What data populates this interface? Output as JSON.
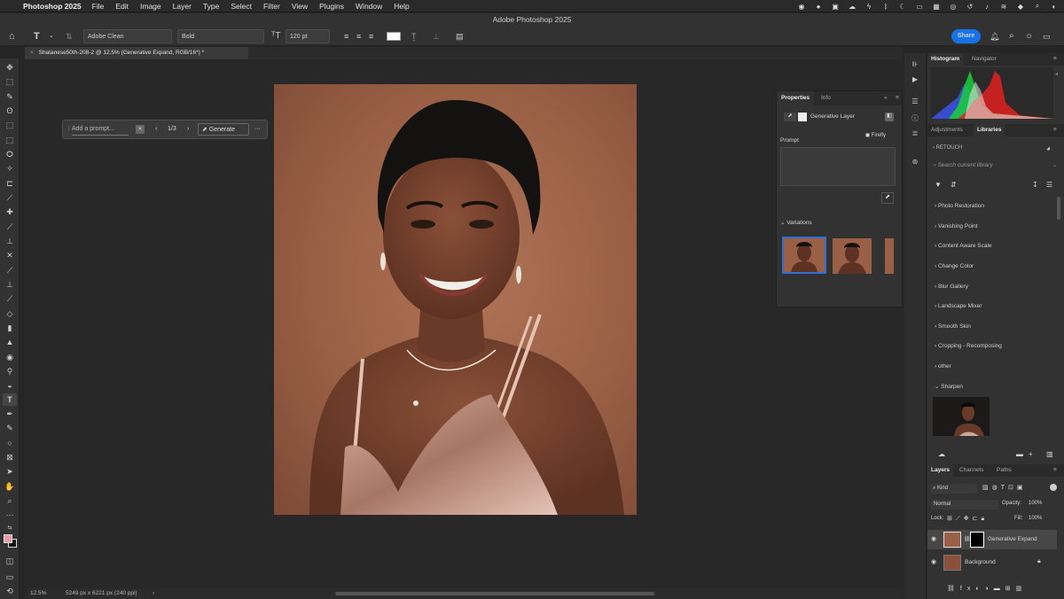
{
  "menubar": {
    "app_name": "Photoshop 2025",
    "items": [
      "File",
      "Edit",
      "Image",
      "Layer",
      "Type",
      "Select",
      "Filter",
      "View",
      "Plugins",
      "Window",
      "Help"
    ]
  },
  "window_title": "Adobe Photoshop 2025",
  "options": {
    "font_family": "Adobe Clean",
    "font_style": "Bold",
    "font_size": "120 pt",
    "share_label": "Share"
  },
  "document_tab": "Shatanese50th-208-2 @ 12.5% (Generative Expand, RGB/16*) *",
  "taskbar": {
    "prompt_placeholder": "Add a prompt...",
    "variation_counter": "1/3",
    "generate_label": "Generate"
  },
  "properties": {
    "tab_properties": "Properties",
    "tab_info": "Info",
    "layer_type": "Generative Layer",
    "prompt_label": "Prompt",
    "firefly_label": "Firefly",
    "variations_label": "Variations"
  },
  "histogram": {
    "tab_histogram": "Histogram",
    "tab_navigator": "Navigator"
  },
  "libraries": {
    "tab_adjustments": "Adjustments",
    "tab_libraries": "Libraries",
    "library_name": "RETOUCH",
    "search_placeholder": "Search current library",
    "items": [
      "Photo Restoration",
      "Vanishing Point",
      "Content Aware Scale",
      "Change Color",
      "Blur Gallery",
      "Landscape Mixer",
      "Smooth Skin",
      "Cropping - Recomposing",
      "other",
      "Sharpen"
    ]
  },
  "layers": {
    "tab_layers": "Layers",
    "tab_channels": "Channels",
    "tab_paths": "Paths",
    "filter_kind": "Kind",
    "blend_mode": "Normal",
    "opacity_label": "Opacity:",
    "opacity_value": "100%",
    "lock_label": "Lock:",
    "fill_label": "Fill:",
    "fill_value": "100%",
    "rows": [
      {
        "name": "Generative Expand"
      },
      {
        "name": "Background"
      }
    ]
  },
  "status": {
    "zoom": "12.5%",
    "doc_size": "5249 px x 6221 px (240 ppi)"
  }
}
